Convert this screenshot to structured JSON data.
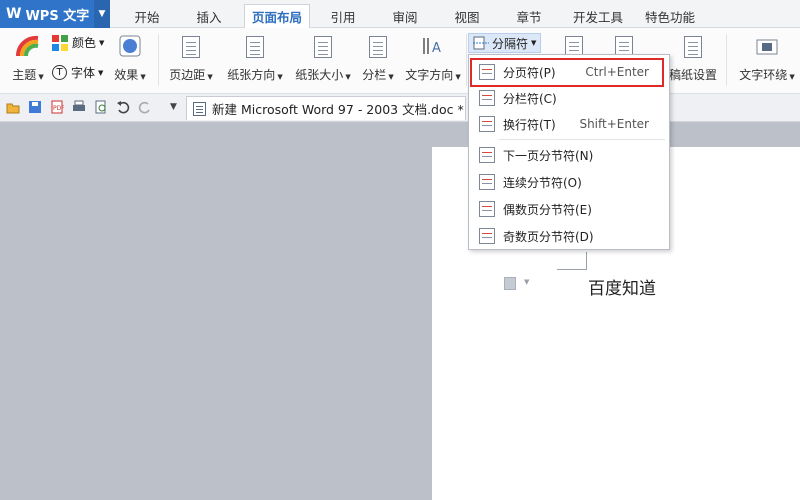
{
  "app": {
    "logo": "W",
    "name": "WPS 文字"
  },
  "tabs": [
    "开始",
    "插入",
    "页面布局",
    "引用",
    "审阅",
    "视图",
    "章节",
    "开发工具",
    "特色功能"
  ],
  "active_tab": "页面布局",
  "ribbon": {
    "theme": "主题",
    "color": "颜色",
    "font": "字体",
    "effect": "效果",
    "margins": "页边距",
    "orientation": "纸张方向",
    "size": "纸张大小",
    "columns": "分栏",
    "text_direction": "文字方向",
    "breaks": "分隔符",
    "manuscript": "稿纸设置",
    "wrap": "文字环绕"
  },
  "doc_tab": {
    "title": "新建 Microsoft Word 97 - 2003 文档.doc *"
  },
  "break_menu": {
    "items": [
      {
        "label": "分页符(P)",
        "shortcut": "Ctrl+Enter"
      },
      {
        "label": "分栏符(C)",
        "shortcut": ""
      },
      {
        "label": "换行符(T)",
        "shortcut": "Shift+Enter"
      },
      {
        "label": "下一页分节符(N)",
        "shortcut": ""
      },
      {
        "label": "连续分节符(O)",
        "shortcut": ""
      },
      {
        "label": "偶数页分节符(E)",
        "shortcut": ""
      },
      {
        "label": "奇数页分节符(D)",
        "shortcut": ""
      }
    ]
  },
  "document": {
    "text": "百度知道"
  },
  "colors": {
    "accent": "#2f74c9",
    "highlight": "#e02a2a"
  }
}
